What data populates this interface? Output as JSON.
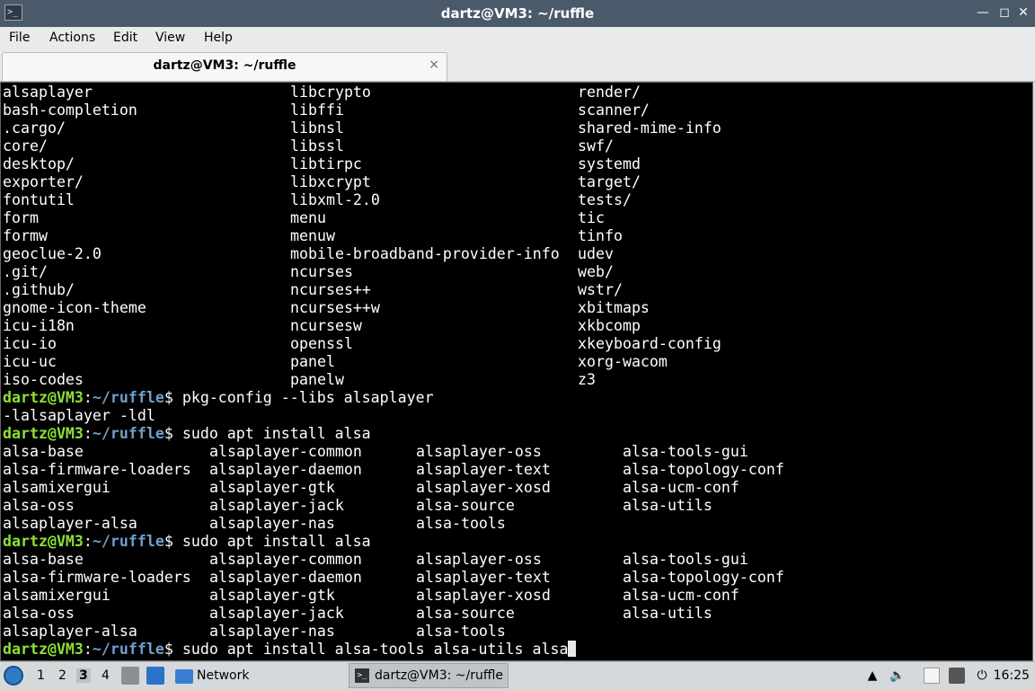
{
  "window": {
    "title": "dartz@VM3: ~/ruffle",
    "terminal_icon": ">_"
  },
  "menu": [
    "File",
    "Actions",
    "Edit",
    "View",
    "Help"
  ],
  "tab": {
    "label": "dartz@VM3: ~/ruffle",
    "close": "×"
  },
  "prompt": {
    "user": "dartz@VM3",
    "sep": ":",
    "path": "~/ruffle",
    "dollar": "$"
  },
  "listing": [
    [
      "alsaplayer",
      "libcrypto",
      "render/"
    ],
    [
      "bash-completion",
      "libffi",
      "scanner/"
    ],
    [
      ".cargo/",
      "libnsl",
      "shared-mime-info"
    ],
    [
      "core/",
      "libssl",
      "swf/"
    ],
    [
      "desktop/",
      "libtirpc",
      "systemd"
    ],
    [
      "exporter/",
      "libxcrypt",
      "target/"
    ],
    [
      "fontutil",
      "libxml-2.0",
      "tests/"
    ],
    [
      "form",
      "menu",
      "tic"
    ],
    [
      "formw",
      "menuw",
      "tinfo"
    ],
    [
      "geoclue-2.0",
      "mobile-broadband-provider-info",
      "udev"
    ],
    [
      ".git/",
      "ncurses",
      "web/"
    ],
    [
      ".github/",
      "ncurses++",
      "wstr/"
    ],
    [
      "gnome-icon-theme",
      "ncurses++w",
      "xbitmaps"
    ],
    [
      "icu-i18n",
      "ncursesw",
      "xkbcomp"
    ],
    [
      "icu-io",
      "openssl",
      "xkeyboard-config"
    ],
    [
      "icu-uc",
      "panel",
      "xorg-wacom"
    ],
    [
      "iso-codes",
      "panelw",
      "z3"
    ]
  ],
  "cmd1": " pkg-config --libs alsaplayer",
  "out1": "-lalsaplayer -ldl",
  "cmd2": " sudo apt install alsa",
  "completions": [
    [
      "alsa-base",
      "alsaplayer-common",
      "alsaplayer-oss",
      "alsa-tools-gui"
    ],
    [
      "alsa-firmware-loaders",
      "alsaplayer-daemon",
      "alsaplayer-text",
      "alsa-topology-conf"
    ],
    [
      "alsamixergui",
      "alsaplayer-gtk",
      "alsaplayer-xosd",
      "alsa-ucm-conf"
    ],
    [
      "alsa-oss",
      "alsaplayer-jack",
      "alsa-source",
      "alsa-utils"
    ],
    [
      "alsaplayer-alsa",
      "alsaplayer-nas",
      "alsa-tools"
    ]
  ],
  "cmd3": " sudo apt install alsa",
  "cmd4": " sudo apt install alsa-tools alsa-utils alsa",
  "taskbar": {
    "desktops": [
      "1",
      "2",
      "3",
      "4"
    ],
    "network_label": "Network",
    "task_label": "dartz@VM3: ~/ruffle",
    "clock": "16:25"
  }
}
